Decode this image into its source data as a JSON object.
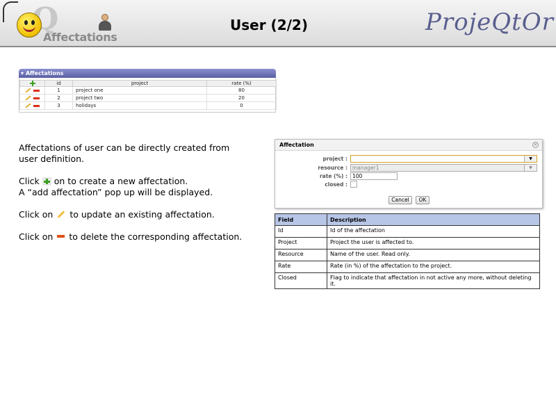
{
  "header": {
    "title": "User (2/2)",
    "section_label": "Affectations",
    "brand": "ProjeQtOr"
  },
  "affectations_panel": {
    "title": "Affectations",
    "columns": [
      "id",
      "project",
      "rate (%)"
    ],
    "rows": [
      {
        "id": "1",
        "project": "project one",
        "rate": "80"
      },
      {
        "id": "2",
        "project": "project two",
        "rate": "20"
      },
      {
        "id": "3",
        "project": "holidays",
        "rate": "0"
      }
    ]
  },
  "description": {
    "intro_line1": "Affectations of user can be directly created from",
    "intro_line2": "user definition.",
    "create_prefix": "Click",
    "create_suffix": "on to create a new affectation.",
    "popup_line": "A “add affectation” pop up will be displayed.",
    "update_prefix": "Click on",
    "update_suffix": "to update an existing affectation.",
    "delete_prefix": "Click on",
    "delete_suffix": "to delete the corresponding affectation."
  },
  "dialog": {
    "title": "Affectation",
    "close_icon": "close-icon",
    "fields": {
      "project_label": "project :",
      "project_value": "",
      "resource_label": "resource :",
      "resource_value": "manager1",
      "rate_label": "rate (%) :",
      "rate_value": "100",
      "closed_label": "closed :"
    },
    "cancel_label": "Cancel",
    "ok_label": "OK"
  },
  "field_table": {
    "headers": {
      "field": "Field",
      "description": "Description"
    },
    "rows": [
      {
        "field": "Id",
        "description": "Id of the affectation"
      },
      {
        "field": "Project",
        "description": "Project the user is affected to."
      },
      {
        "field": "Resource",
        "description": "Name of the user. Read only."
      },
      {
        "field": "Rate",
        "description": "Rate (in %) of the affectation to the project."
      },
      {
        "field": "Closed",
        "description": "Flag to indicate that affectation in not active any more, without deleting it."
      }
    ]
  },
  "colors": {
    "panel_header": "#5a5fa4",
    "table_header": "#b7c5e6",
    "brand": "#5a5f8f",
    "add_icon": "#3aa020",
    "delete_icon": "#d83010",
    "edit_icon": "#e0b030"
  },
  "icons": [
    "add-icon",
    "edit-icon",
    "delete-icon",
    "user-icon",
    "close-icon",
    "chevron-down-icon"
  ]
}
